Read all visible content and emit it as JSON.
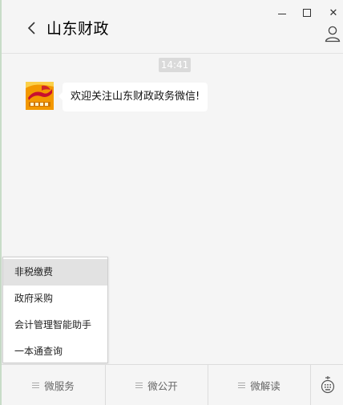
{
  "window": {
    "minimize_icon": "minimize-icon",
    "maximize_icon": "maximize-icon",
    "close_icon": "close-icon",
    "close_glyph": "✕"
  },
  "header": {
    "back_icon": "chevron-left-icon",
    "title": "山东财政",
    "profile_icon": "user-icon"
  },
  "chat": {
    "timestamp": "14:41",
    "messages": [
      {
        "sender_avatar": "shandong-finance-logo",
        "text": "欢迎关注山东财政政务微信!"
      }
    ]
  },
  "popup_menu": {
    "items": [
      {
        "label": "非税缴费",
        "active": true
      },
      {
        "label": "政府采购",
        "active": false
      },
      {
        "label": "会计管理智能助手",
        "active": false
      },
      {
        "label": "一本通查询",
        "active": false
      }
    ]
  },
  "bottom_menu": {
    "items": [
      {
        "label": "微服务"
      },
      {
        "label": "微公开"
      },
      {
        "label": "微解读"
      }
    ],
    "keyboard_icon": "keyboard-toggle-icon"
  },
  "colors": {
    "background": "#f5f5f5",
    "bubble": "#ffffff",
    "timestamp_bg": "#dadada",
    "active_item": "#e2e2e2",
    "logo_primary": "#f39800",
    "logo_accent": "#c8102e"
  }
}
